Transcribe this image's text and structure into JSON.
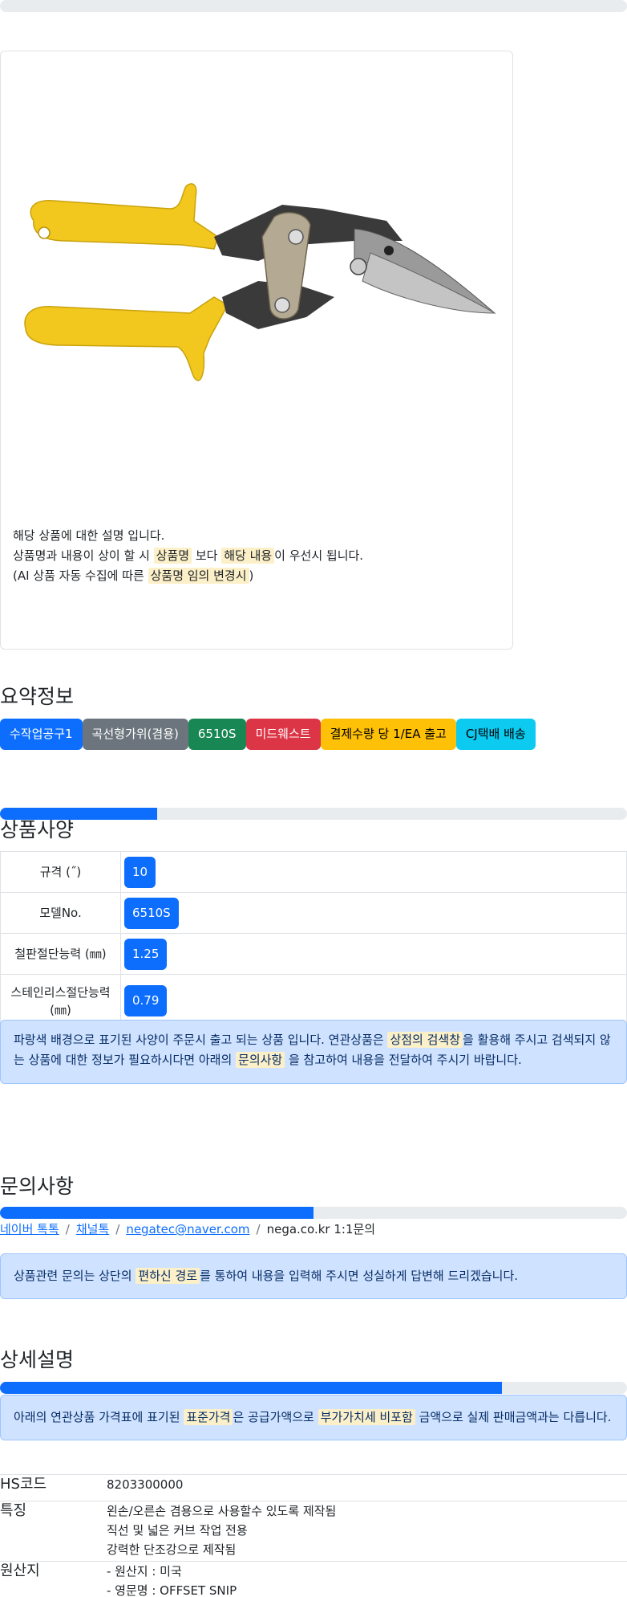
{
  "top_progress": {
    "percent": 0
  },
  "product": {
    "image_icon": "offset-snip-tool-image",
    "note": {
      "line1": "해당 상품에 대한 설명 입니다.",
      "line2_a": "상품명과 내용이 상이 할 시 ",
      "line2_mark1": "상품명",
      "line2_b": " 보다 ",
      "line2_mark2": "해당 내용",
      "line2_c": "이 우선시 됩니다.",
      "line3_a": "(AI 상품 자동 수집에 따른 ",
      "line3_mark": "상품명 임의 변경시",
      "line3_b": ")"
    }
  },
  "summary": {
    "title": "요약정보",
    "badges": [
      {
        "label": "수작업공구1",
        "color": "#0d6efd"
      },
      {
        "label": "곡선형가위(겸용)",
        "color": "#6c757d"
      },
      {
        "label": "6510S",
        "color": "#198754"
      },
      {
        "label": "미드웨스트",
        "color": "#dc3545"
      },
      {
        "label": "결제수량 당 1/EA 출고",
        "color": "#ffc107"
      },
      {
        "label": "CJ택배 배송",
        "color": "#0dcaf0"
      }
    ]
  },
  "spec": {
    "progress_percent": 25,
    "title": "상품사양",
    "rows": [
      {
        "label": "규격 (˝)",
        "value": "10"
      },
      {
        "label": "모델No.",
        "value": "6510S"
      },
      {
        "label": "철판절단능력 (㎜)",
        "value": "1.25"
      },
      {
        "label": "스테인리스절단능력 (㎜)",
        "value": "0.79"
      }
    ],
    "alert": {
      "a": "파랑색 배경으로 표기된 사양이 주문시 출고 되는 상품 입니다. 연관상품은 ",
      "mark1": "상점의 검색창",
      "b": "을 활용해 주시고 검색되지 않는 상품에 대한 정보가 필요하시다면 아래의 ",
      "mark2": "문의사항",
      "c": " 을 참고하여 내용을 전달하여 주시기 바랍니다."
    }
  },
  "inquiry": {
    "title": "문의사항",
    "progress_percent": 50,
    "links": {
      "naver_talk": "네이버 톡톡",
      "channel_talk": "채널톡",
      "email": "negatec@naver.com",
      "qna": "nega.co.kr 1:1문의",
      "sep": "/"
    },
    "alert": {
      "a": "상품관련 문의는 상단의 ",
      "mark": "편하신 경로",
      "b": "를 통하여 내용을 입력해 주시면 성실하게 답변해 드리겠습니다."
    }
  },
  "detail": {
    "title": "상세설명",
    "progress_percent": 80,
    "alert": {
      "a": "아래의 연관상품 가격표에 표기된 ",
      "mark1": "표준가격",
      "b": "은 공급가액으로 ",
      "mark2": "부가가치세 비포함",
      "c": " 금액으로 실제 판매금액과는 다릅니다."
    },
    "table": {
      "hs_label": "HS코드",
      "hs_value": "8203300000",
      "feature_label": "특징",
      "features": [
        "왼손/오른손 겸용으로 사용할수 있도록 제작됨",
        "직선 및 넓은 커브 작업 전용",
        "강력한 단조강으로 제작됨"
      ],
      "origin_label": "원산지",
      "origins": [
        "- 원산지 : 미국",
        "- 영문명 : OFFSET SNIP"
      ]
    }
  }
}
